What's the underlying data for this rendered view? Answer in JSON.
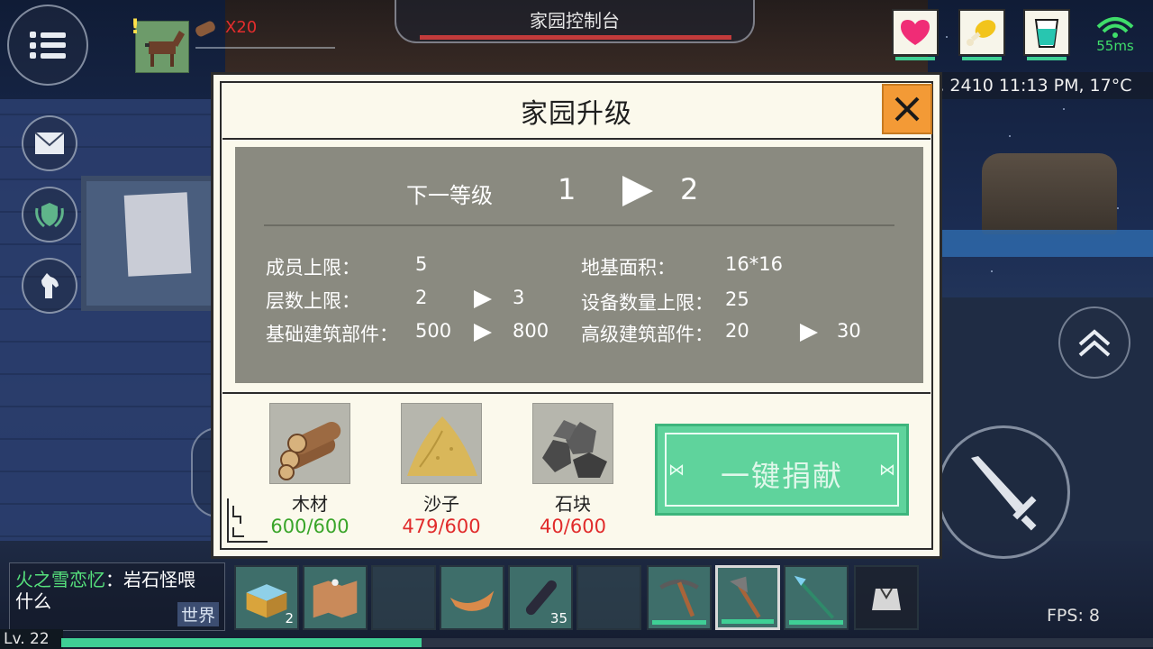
{
  "hud": {
    "quest_count": "X20",
    "console_title": "家园控制台",
    "ping": "55ms",
    "coords_time": "1109, 2410  11:13 PM, 17°C"
  },
  "dialog": {
    "title": "家园升级",
    "next_level_label": "下一等级",
    "level_from": "1",
    "level_to": "2",
    "stats": {
      "members_label": "成员上限：",
      "members_value": "5",
      "floors_label": "层数上限：",
      "floors_from": "2",
      "floors_to": "3",
      "basic_parts_label": "基础建筑部件：",
      "basic_parts_from": "500",
      "basic_parts_to": "800",
      "foundation_label": "地基面积：",
      "foundation_value": "16*16",
      "devices_label": "设备数量上限：",
      "devices_value": "25",
      "adv_parts_label": "高级建筑部件：",
      "adv_parts_from": "20",
      "adv_parts_to": "30"
    },
    "resources": [
      {
        "name": "木材",
        "qty": "600/600",
        "status": "ok"
      },
      {
        "name": "沙子",
        "qty": "479/600",
        "status": "short"
      },
      {
        "name": "石块",
        "qty": "40/600",
        "status": "short"
      }
    ],
    "donate_label": "一键捐献"
  },
  "chat": {
    "sender": "火之雪恋忆",
    "message_line1": "：岩石怪喂",
    "message_line2": "什么",
    "channel": "世界"
  },
  "player": {
    "level": "Lv. 22",
    "xp_fraction": 0.33
  },
  "hotbar": [
    {
      "item": "chest-icon",
      "count": "2"
    },
    {
      "item": "map-icon",
      "count": ""
    },
    {
      "item": "empty",
      "count": ""
    },
    {
      "item": "boat-icon",
      "count": ""
    },
    {
      "item": "log-icon",
      "count": "35"
    },
    {
      "item": "empty",
      "count": ""
    },
    {
      "item": "pickaxe-icon",
      "count": ""
    },
    {
      "item": "axe-icon",
      "count": ""
    },
    {
      "item": "spear-icon",
      "count": ""
    }
  ],
  "fps": "FPS: 8",
  "colors": {
    "accent_green": "#5fd39c",
    "close_orange": "#f39a36",
    "short_red": "#e12b2b",
    "ok_green": "#3aa52a"
  }
}
